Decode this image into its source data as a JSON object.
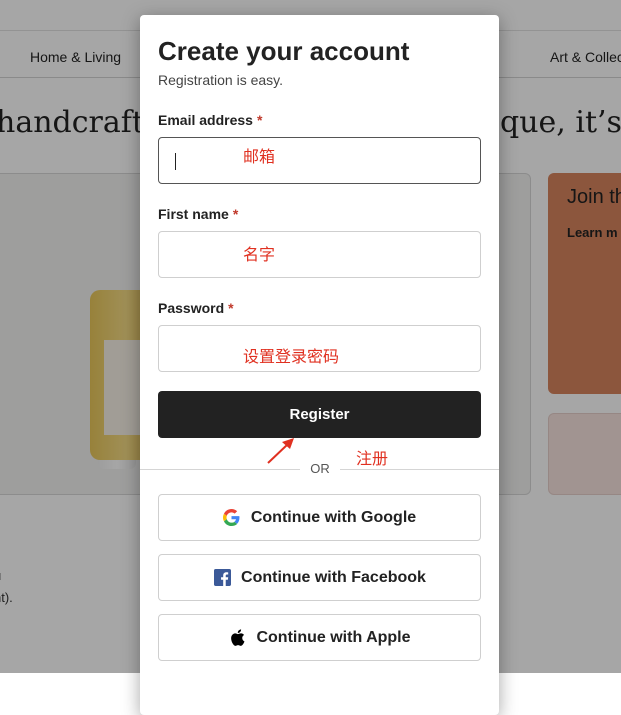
{
  "background": {
    "nav": [
      "Home & Living",
      "Art & Collec"
    ],
    "hero_left": "handcrafte",
    "hero_right": "que, it’s o",
    "promo_title": "Join th",
    "promo_link": "Learn m",
    "side_text_1": "u",
    "side_text_2": "nt)."
  },
  "modal": {
    "title": "Create your account",
    "subtitle": "Registration is easy.",
    "email_label": "Email address",
    "first_name_label": "First name",
    "password_label": "Password",
    "required_mark": "*",
    "register_label": "Register",
    "or_label": "OR",
    "google_label": "Continue with Google",
    "facebook_label": "Continue with Facebook",
    "apple_label": "Continue with Apple"
  },
  "annotations": {
    "email": "邮箱",
    "first_name": "名字",
    "password": "设置登录密码",
    "register": "注册"
  },
  "colors": {
    "accent_dark": "#222222",
    "annotation_red": "#e03020",
    "required_red": "#c0392b",
    "promo_orange": "#d7855f"
  },
  "icons": [
    "google-icon",
    "facebook-icon",
    "apple-icon",
    "arrow-annotation"
  ]
}
